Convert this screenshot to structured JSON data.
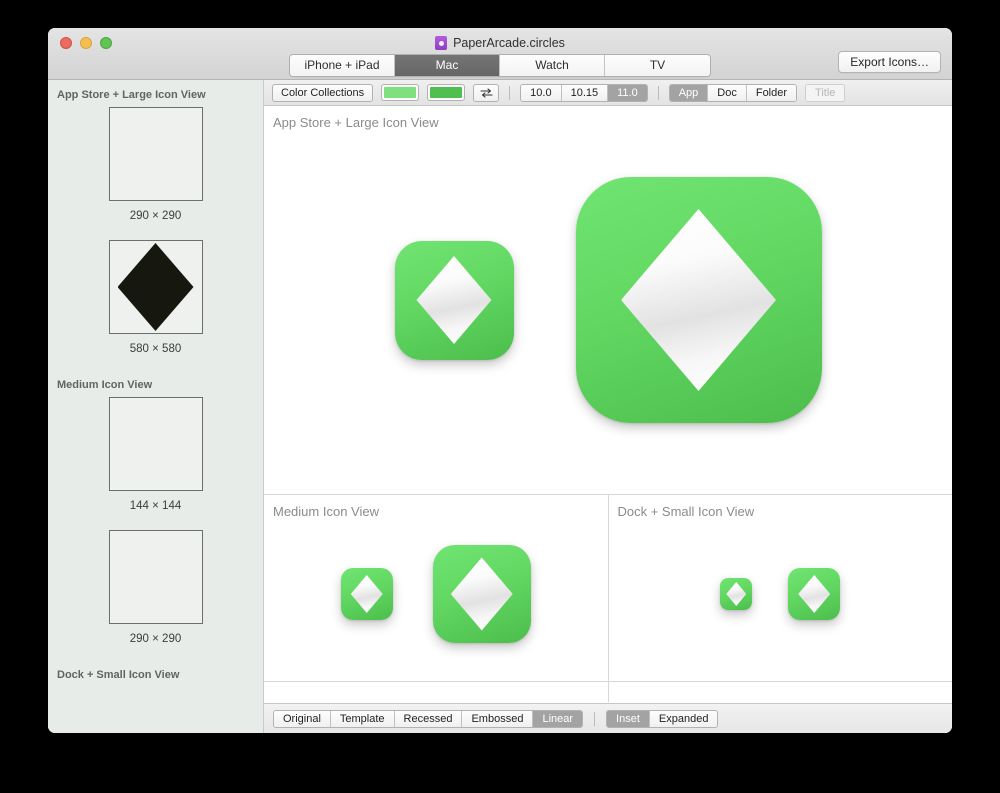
{
  "window": {
    "title": "PaperArcade.circles",
    "doc_icon": "purple-document-icon",
    "traffic_lights": {
      "close": "close-button",
      "minimize": "minimize-button",
      "zoom": "zoom-button",
      "close_color": "#ed6a5e",
      "minimize_color": "#f5bf4f",
      "zoom_color": "#61c554"
    }
  },
  "toolbar": {
    "platform_tabs": [
      {
        "label": "iPhone + iPad",
        "selected": false
      },
      {
        "label": "Mac",
        "selected": true
      },
      {
        "label": "Watch",
        "selected": false
      },
      {
        "label": "TV",
        "selected": false
      }
    ],
    "export_button": "Export Icons…"
  },
  "options_bar": {
    "color_collections_label": "Color Collections",
    "swatch_light": "#7ee07e",
    "swatch_dark": "#4fbf4f",
    "swap_icon": "swap-arrows-icon",
    "os_versions": [
      {
        "label": "10.0",
        "selected": false
      },
      {
        "label": "10.15",
        "selected": false
      },
      {
        "label": "11.0",
        "selected": true
      }
    ],
    "icon_kinds": [
      {
        "label": "App",
        "selected": true,
        "disabled": false
      },
      {
        "label": "Doc",
        "selected": false,
        "disabled": false
      },
      {
        "label": "Folder",
        "selected": false,
        "disabled": false
      },
      {
        "label": "Title",
        "selected": false,
        "disabled": true
      }
    ]
  },
  "sidebar": {
    "sections": [
      {
        "header": "App Store + Large Icon View",
        "items": [
          {
            "size_label": "290 × 290",
            "has_shape": false
          },
          {
            "size_label": "580 × 580",
            "has_shape": true,
            "shape": "black-diamond-shape"
          }
        ]
      },
      {
        "header": "Medium Icon View",
        "items": [
          {
            "size_label": "144 × 144",
            "has_shape": false
          },
          {
            "size_label": "290 × 290",
            "has_shape": false
          }
        ]
      },
      {
        "header": "Dock + Small Icon View",
        "items": []
      }
    ]
  },
  "preview": {
    "sections": [
      {
        "title": "App Store + Large Icon View"
      },
      {
        "title": "Medium Icon View"
      },
      {
        "title": "Dock + Small Icon View"
      }
    ],
    "icon_colors": {
      "background_light": "#71e472",
      "background_dark": "#4cbd4c",
      "glyph": "#ffffff",
      "glyph_shape": "diamond"
    }
  },
  "bottom_bar": {
    "styles": [
      {
        "label": "Original",
        "selected": false
      },
      {
        "label": "Template",
        "selected": false
      },
      {
        "label": "Recessed",
        "selected": false
      },
      {
        "label": "Embossed",
        "selected": false
      },
      {
        "label": "Linear",
        "selected": true
      }
    ],
    "fits": [
      {
        "label": "Inset",
        "selected": true
      },
      {
        "label": "Expanded",
        "selected": false
      }
    ]
  }
}
